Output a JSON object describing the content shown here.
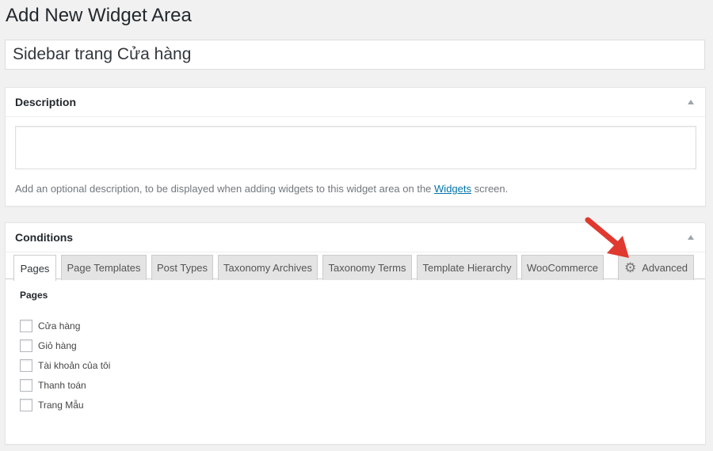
{
  "page": {
    "title": "Add New Widget Area"
  },
  "title_field": {
    "value": "Sidebar trang Cửa hàng"
  },
  "description_box": {
    "title": "Description",
    "textarea_value": "",
    "hint_prefix": "Add an optional description, to be displayed when adding widgets to this widget area on the ",
    "hint_link": "Widgets",
    "hint_suffix": " screen."
  },
  "conditions_box": {
    "title": "Conditions",
    "tabs": [
      {
        "label": "Pages",
        "active": true
      },
      {
        "label": "Page Templates"
      },
      {
        "label": "Post Types"
      },
      {
        "label": "Taxonomy Archives"
      },
      {
        "label": "Taxonomy Terms"
      },
      {
        "label": "Template Hierarchy"
      },
      {
        "label": "WooCommerce"
      },
      {
        "label": "Advanced",
        "icon": "gear-icon"
      }
    ],
    "pages_heading": "Pages",
    "pages": [
      {
        "label": "Cửa hàng",
        "checked": false
      },
      {
        "label": "Giỏ hàng",
        "checked": false
      },
      {
        "label": "Tài khoản của tôi",
        "checked": false
      },
      {
        "label": "Thanh toán",
        "checked": false
      },
      {
        "label": "Trang Mẫu",
        "checked": false
      }
    ]
  },
  "colors": {
    "accent_link": "#0073aa",
    "annotation_arrow": "#e0392f"
  }
}
